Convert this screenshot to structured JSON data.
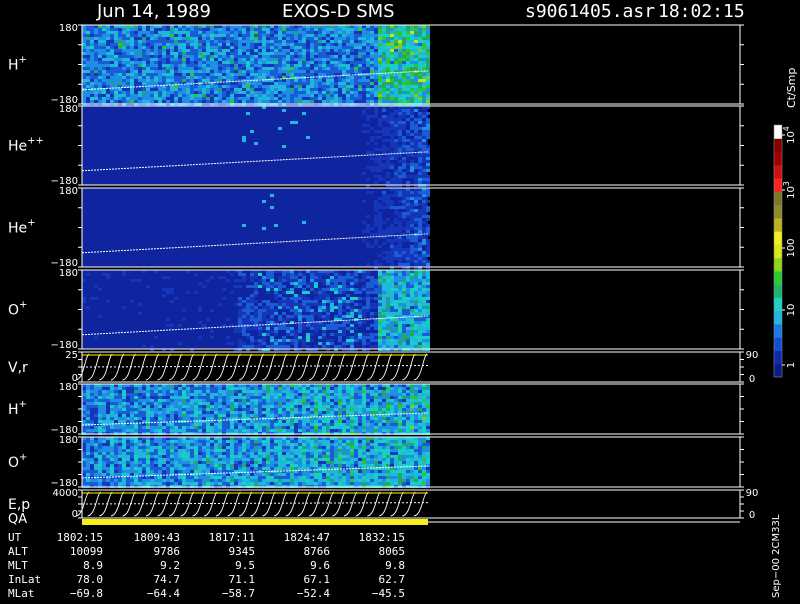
{
  "header": {
    "date": "Jun 14, 1989",
    "title": "EXOS-D SMS",
    "file": "s9061405.asr",
    "time": "18:02:15"
  },
  "panels": [
    {
      "key": "p1",
      "label": "H",
      "sup": "+",
      "top": "180",
      "bottom": "−180",
      "kind": "spectrogram",
      "density": "high"
    },
    {
      "key": "p2",
      "label": "He",
      "sup": "++",
      "top": "180",
      "bottom": "−180",
      "kind": "spectrogram",
      "density": "low"
    },
    {
      "key": "p3",
      "label": "He",
      "sup": "+",
      "top": "180",
      "bottom": "−180",
      "kind": "spectrogram",
      "density": "low"
    },
    {
      "key": "p4",
      "label": "O",
      "sup": "+",
      "top": "180",
      "bottom": "−180",
      "kind": "spectrogram",
      "density": "mid"
    },
    {
      "key": "p5",
      "label": "V,r",
      "sup": "",
      "top": "25",
      "bottom": "0",
      "kind": "lines",
      "right_top": "90",
      "right_bottom": "0"
    },
    {
      "key": "p6",
      "label": "H",
      "sup": "+",
      "top": "180",
      "bottom": "−180",
      "kind": "spectrogram",
      "density": "stripes"
    },
    {
      "key": "p7",
      "label": "O",
      "sup": "+",
      "top": "180",
      "bottom": "−180",
      "kind": "spectrogram",
      "density": "stripes"
    },
    {
      "key": "p8",
      "label": "E,p",
      "sup": "",
      "top": "4000",
      "bottom": "0",
      "kind": "lines",
      "right_top": "90",
      "right_bottom": "0"
    }
  ],
  "qa_label": "QA",
  "colorbar": {
    "unit_label": "Ct/Smp",
    "ticks": [
      {
        "label": "1",
        "sup": ""
      },
      {
        "label": "10",
        "sup": ""
      },
      {
        "label": "100",
        "sup": ""
      },
      {
        "label": "10",
        "sup": "3"
      },
      {
        "label": "10",
        "sup": "4"
      }
    ],
    "colors": [
      "#0b1a8a",
      "#0d2ab0",
      "#1050d0",
      "#1a7ae8",
      "#22b6e0",
      "#20d0c8",
      "#1fb46e",
      "#2ecb2e",
      "#8bd81b",
      "#d8e81a",
      "#f3f020",
      "#c0b020",
      "#8f8a2a",
      "#7c7a2a",
      "#ff2020",
      "#d01010",
      "#a00000",
      "#800000",
      "#ffffff"
    ]
  },
  "time_table": {
    "rows": [
      {
        "label": "UT",
        "values": [
          "1802:15",
          "1809:43",
          "1817:11",
          "1824:47",
          "1832:15"
        ]
      },
      {
        "label": "ALT",
        "values": [
          "10099",
          "9786",
          "9345",
          "8766",
          "8065"
        ]
      },
      {
        "label": "MLT",
        "values": [
          "8.9",
          "9.2",
          "9.5",
          "9.6",
          "9.8"
        ]
      },
      {
        "label": "InLat",
        "values": [
          "78.0",
          "74.7",
          "71.1",
          "67.1",
          "62.7"
        ]
      },
      {
        "label": "MLat",
        "values": [
          "−69.8",
          "−64.4",
          "−58.7",
          "−52.4",
          "−45.5"
        ]
      }
    ]
  },
  "footer_note": "Sep−00 2CM33L",
  "chart_data": {
    "type": "heatmap",
    "title": "Jun 14, 1989   EXOS-D SMS",
    "subtitle": "s9061405.asr  18:02:15",
    "x_ticks": [
      "1802:15",
      "1809:43",
      "1817:11",
      "1824:47",
      "1832:15"
    ],
    "series": [
      {
        "name": "H+",
        "ylim": [
          -180,
          180
        ]
      },
      {
        "name": "He++",
        "ylim": [
          -180,
          180
        ]
      },
      {
        "name": "He+",
        "ylim": [
          -180,
          180
        ]
      },
      {
        "name": "O+",
        "ylim": [
          -180,
          180
        ]
      },
      {
        "name": "V,r",
        "ylim": [
          0,
          25
        ]
      },
      {
        "name": "H+",
        "ylim": [
          -180,
          180
        ]
      },
      {
        "name": "O+",
        "ylim": [
          -180,
          180
        ]
      },
      {
        "name": "E,p",
        "ylim": [
          0,
          4000
        ]
      }
    ],
    "colorbar_label": "Ct/Smp",
    "colorbar_ticks": [
      "1",
      "10",
      "100",
      "10^3",
      "10^4"
    ]
  }
}
